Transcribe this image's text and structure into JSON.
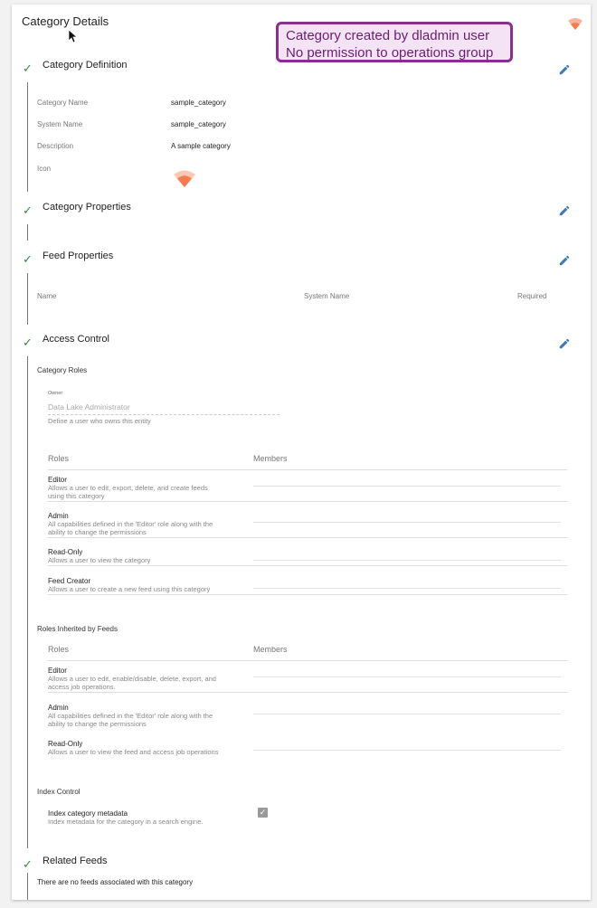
{
  "page": {
    "title": "Category Details"
  },
  "annotation": {
    "line1": "Category created by dladmin user",
    "line2": "No permission to operations group"
  },
  "steps": {
    "definition": {
      "title": "Category Definition"
    },
    "properties": {
      "title": "Category Properties"
    },
    "feed_properties": {
      "title": "Feed Properties"
    },
    "access_control": {
      "title": "Access Control"
    },
    "related_feeds": {
      "title": "Related Feeds"
    }
  },
  "definition": {
    "fields": [
      {
        "label": "Category Name",
        "value": "sample_category"
      },
      {
        "label": "System Name",
        "value": "sample_category"
      },
      {
        "label": "Description",
        "value": "A sample category"
      },
      {
        "label": "Icon",
        "value": ""
      }
    ]
  },
  "feed_properties": {
    "columns": [
      "Name",
      "System Name",
      "Required"
    ]
  },
  "access": {
    "category_roles_header": "Category Roles",
    "owner": {
      "label": "Owner",
      "value": "Data Lake Administrator",
      "hint": "Define a user who owns this entity"
    },
    "roles_header": "Roles",
    "members_header": "Members",
    "category_roles": [
      {
        "name": "Editor",
        "desc1": "Allows a user to edit, export, delete, and create feeds",
        "desc2": "using this category"
      },
      {
        "name": "Admin",
        "desc1": "All capabilities defined in the 'Editor' role along with the",
        "desc2": "ability to change the permissions"
      },
      {
        "name": "Read-Only",
        "desc1": "Allows a user to view the category",
        "desc2": ""
      },
      {
        "name": "Feed Creator",
        "desc1": "Allows a user to create a new feed using this category",
        "desc2": ""
      }
    ],
    "inherited_header": "Roles Inherited by Feeds",
    "inherited_roles": [
      {
        "name": "Editor",
        "desc1": "Allows a user to edit, enable/disable, delete, export, and",
        "desc2": "access job operations."
      },
      {
        "name": "Admin",
        "desc1": "All capabilities defined in the 'Editor' role along with the",
        "desc2": "ability to change the permissions"
      },
      {
        "name": "Read-Only",
        "desc1": "Allows a user to view the feed and access job operations",
        "desc2": ""
      }
    ],
    "index_header": "Index Control",
    "index": {
      "label": "Index category metadata",
      "hint": "Index metadata for the category in a search engine.",
      "checked": true
    }
  },
  "related": {
    "empty_text": "There are no feeds associated with this category"
  },
  "icons": {
    "category_icon": "wifi-icon",
    "category_icon_color": "#f47c4f",
    "edit_icon": "pencil-icon",
    "check_icon": "check-icon",
    "accent": "#3a7ab6",
    "check_color": "#2e8b3d"
  }
}
